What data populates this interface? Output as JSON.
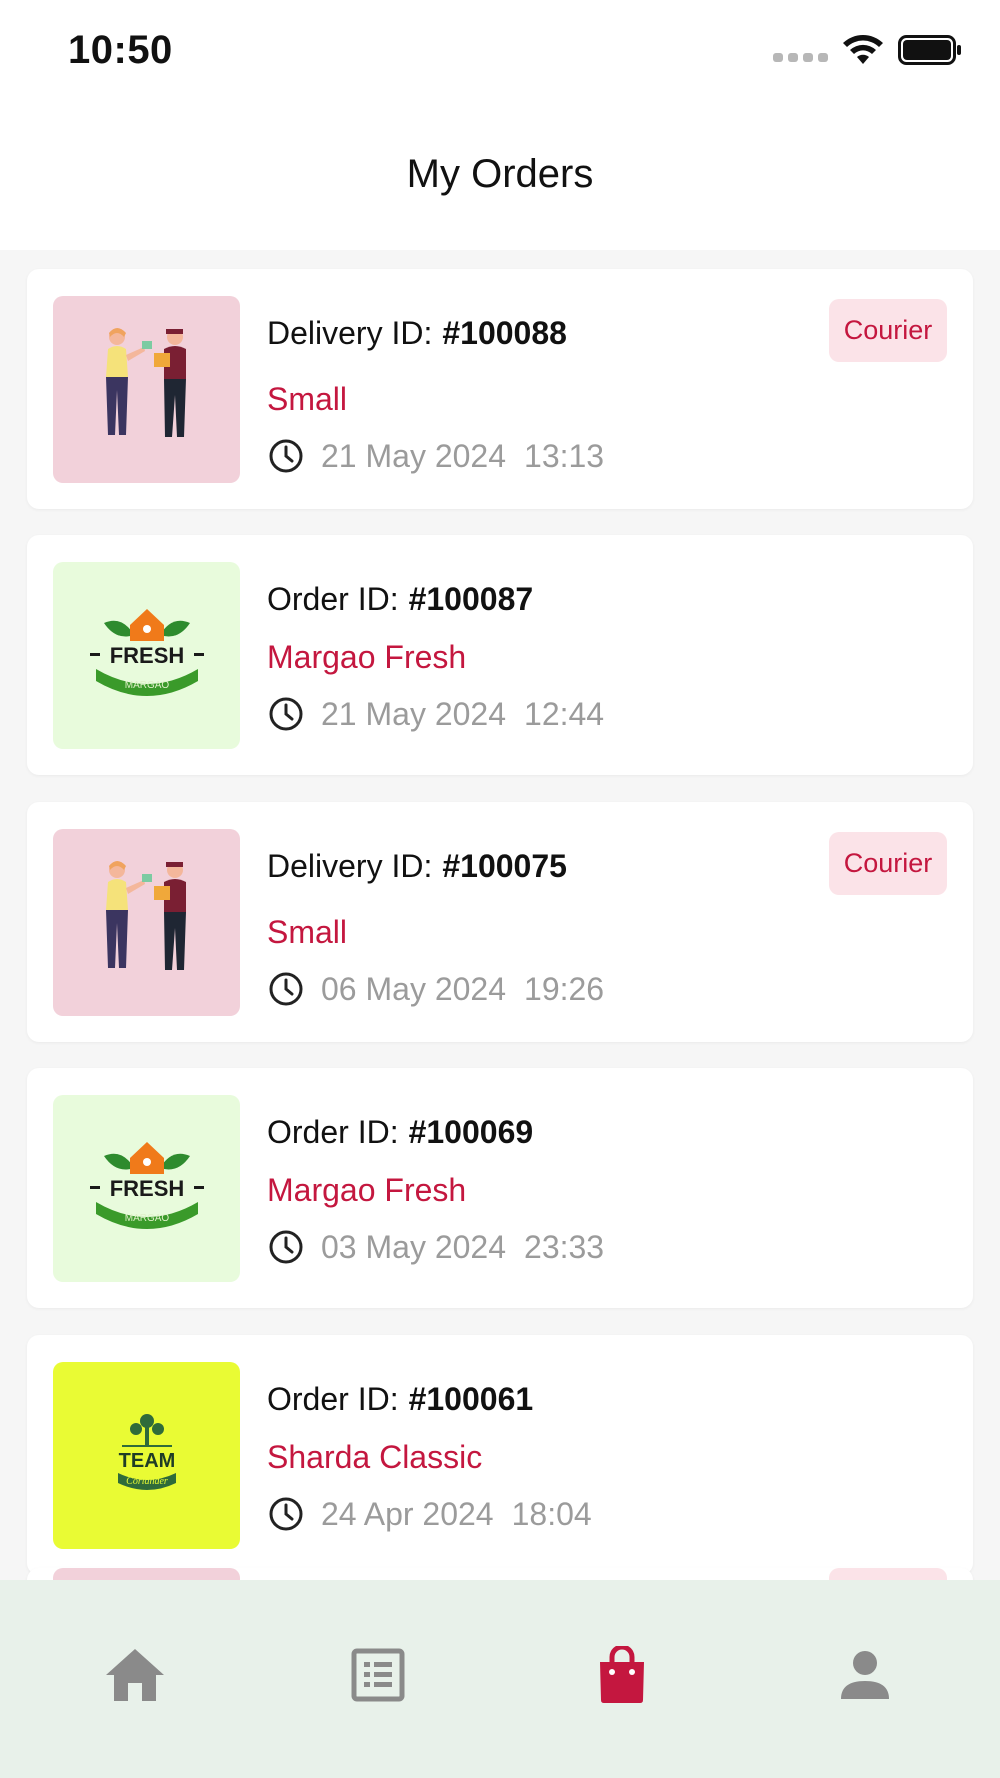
{
  "status_bar": {
    "time": "10:50"
  },
  "header": {
    "title": "My Orders"
  },
  "orders": [
    {
      "id_label": "Delivery ID:",
      "id_value": "#100088",
      "store": "Small",
      "date": "21 May 2024",
      "time": "13:13",
      "badge": "Courier",
      "thumb": "courier-illustration-icon"
    },
    {
      "id_label": "Order ID:",
      "id_value": "#100087",
      "store": "Margao Fresh",
      "date": "21 May 2024",
      "time": "12:44",
      "thumb": "margao-fresh-logo"
    },
    {
      "id_label": "Delivery ID:",
      "id_value": "#100075",
      "store": "Small",
      "date": "06 May 2024",
      "time": "19:26",
      "badge": "Courier",
      "thumb": "courier-illustration-icon"
    },
    {
      "id_label": "Order ID:",
      "id_value": "#100069",
      "store": "Margao Fresh",
      "date": "03 May 2024",
      "time": "23:33",
      "thumb": "margao-fresh-logo"
    },
    {
      "id_label": "Order ID:",
      "id_value": "#100061",
      "store": "Sharda Classic",
      "date": "24 Apr 2024",
      "time": "18:04",
      "thumb": "team-coriander-logo"
    }
  ],
  "logos": {
    "fresh_word": "FRESH",
    "fresh_sub": "MARGAO",
    "team_word": "TEAM",
    "team_sub": "Coriander"
  },
  "bottom_nav": {
    "items": [
      {
        "icon": "home-icon",
        "active": false
      },
      {
        "icon": "list-icon",
        "active": false
      },
      {
        "icon": "shopping-bag-icon",
        "active": true
      },
      {
        "icon": "profile-icon",
        "active": false
      }
    ]
  },
  "colors": {
    "accent": "#c4173f",
    "inactive_icon": "#8a8a8a",
    "nav_background": "#e8f1ea",
    "courier_thumb": "#f2d1da",
    "fresh_thumb": "#e8fbdc",
    "team_thumb": "#e9fb34"
  }
}
